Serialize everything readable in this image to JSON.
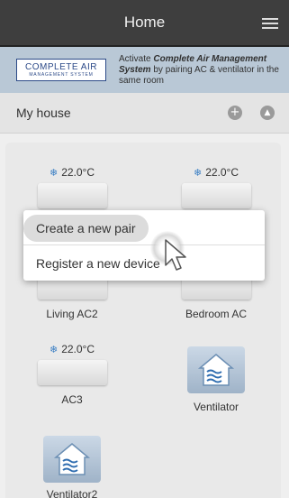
{
  "header": {
    "title": "Home"
  },
  "banner": {
    "logo_main": "COMPLETE AIR",
    "logo_sub": "MANAGEMENT SYSTEM",
    "text_prefix": "Activate ",
    "text_emph": "Complete Air Management System",
    "text_suffix": " by pairing AC & ventilator in the same room"
  },
  "subheader": {
    "house_name": "My house"
  },
  "devices": [
    {
      "temp": "22.0°C",
      "name": "Living AC2"
    },
    {
      "temp": "22.0°C",
      "name": "Bedroom AC"
    },
    {
      "temp": "22.0°C",
      "name": "AC3"
    },
    {
      "name": "Ventilator"
    },
    {
      "name": "Ventilator2"
    }
  ],
  "menu": {
    "option1": "Create a new pair",
    "option2": "Register a new device"
  },
  "colors": {
    "header": "#3e3e3e",
    "banner": "#b9c8d6",
    "accent": "#3b7fc4"
  }
}
